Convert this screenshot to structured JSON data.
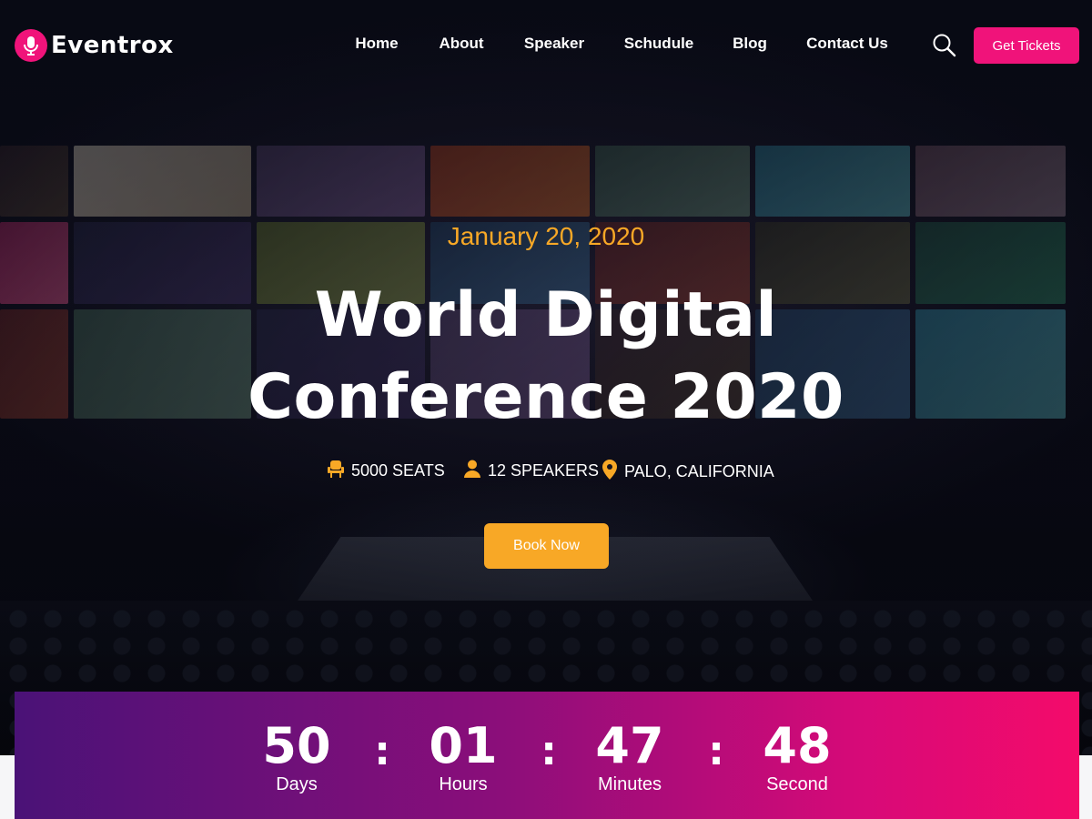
{
  "brand": {
    "name": "Eventrox",
    "icon": "microphone-icon",
    "accent_color": "#f0137a"
  },
  "nav": {
    "items": [
      {
        "label": "Home"
      },
      {
        "label": "About"
      },
      {
        "label": "Speaker"
      },
      {
        "label": "Schudule"
      },
      {
        "label": "Blog"
      },
      {
        "label": "Contact Us"
      }
    ],
    "search_icon": "search-icon",
    "cta_label": "Get Tickets"
  },
  "hero": {
    "date": "January 20, 2020",
    "title_line1": "World Digital",
    "title_line2": "Conference 2020",
    "meta": [
      {
        "icon": "seat-icon",
        "text": "5000 SEATS"
      },
      {
        "icon": "user-icon",
        "text": "12 SPEAKERS"
      },
      {
        "icon": "location-pin-icon",
        "text": "PALO, CALIFORNIA"
      }
    ],
    "button_label": "Book Now",
    "accent_color": "#f8a826"
  },
  "countdown": {
    "units": [
      {
        "value": "50",
        "label": "Days"
      },
      {
        "value": "01",
        "label": "Hours"
      },
      {
        "value": "47",
        "label": "Minutes"
      },
      {
        "value": "48",
        "label": "Second"
      }
    ],
    "separator": ":"
  }
}
